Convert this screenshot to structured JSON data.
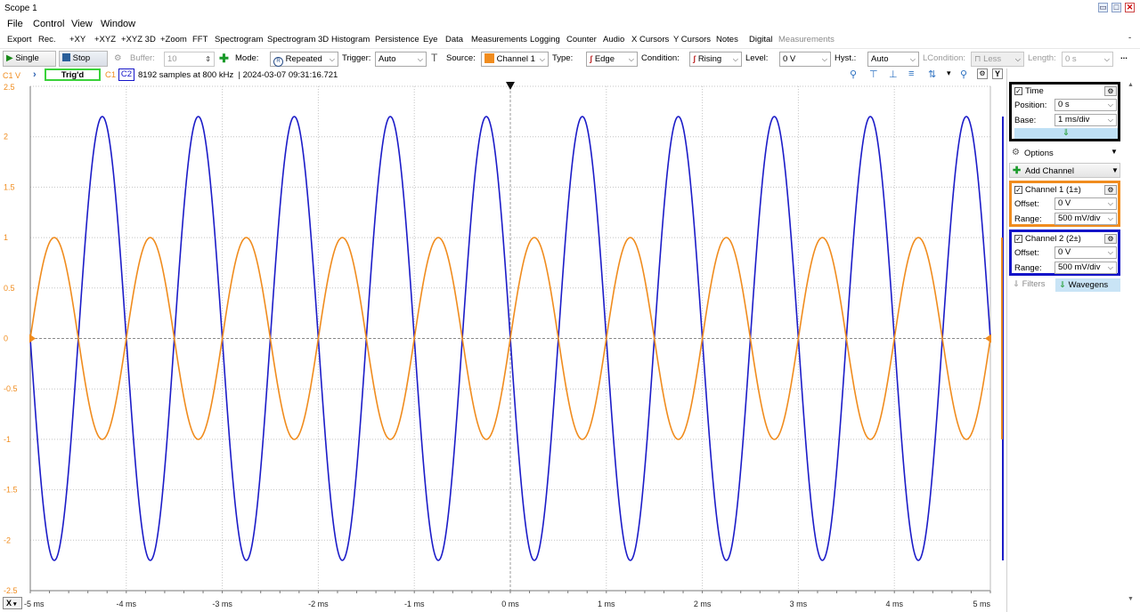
{
  "window": {
    "title": "Scope 1"
  },
  "menu": [
    "File",
    "Control",
    "View",
    "Window"
  ],
  "toolbar1": {
    "items": [
      "Export",
      "Rec.",
      "+XY",
      "+XYZ",
      "+XYZ 3D",
      "+Zoom",
      "FFT",
      "Spectrogram",
      "Spectrogram 3D",
      "Histogram",
      "Persistence",
      "Eye",
      "Data",
      "Measurements",
      "Logging",
      "Counter",
      "Audio",
      "X Cursors",
      "Y Cursors",
      "Notes",
      "Digital"
    ],
    "disabled_item": "Measurements"
  },
  "toolbar2": {
    "single_label": "Single",
    "stop_label": "Stop",
    "buffer_label": "Buffer:",
    "buffer_value": "10",
    "mode_label": "Mode:",
    "mode_value": "Repeated",
    "trigger_label": "Trigger:",
    "trigger_value": "Auto",
    "source_label": "Source:",
    "source_value": "Channel 1",
    "type_label": "Type:",
    "type_value": "Edge",
    "condition_label": "Condition:",
    "condition_value": "Rising",
    "level_label": "Level:",
    "level_value": "0 V",
    "hyst_label": "Hyst.:",
    "hyst_value": "Auto",
    "lcondition_label": "LCondition:",
    "lcondition_value": "Less",
    "length_label": "Length:",
    "length_value": "0 s",
    "more_label": "..."
  },
  "status": {
    "unit_label": "C1 V",
    "trig_label": "Trig'd",
    "c1_label": "C1",
    "c2_label": "C2",
    "info": "8192 samples at 800 kHz  | 2024-03-07 09:31:16.721",
    "y_button": "Y"
  },
  "chart_data": {
    "type": "line",
    "title": "",
    "xlabel": "",
    "ylabel": "C1 V",
    "x_unit": "ms",
    "xlim": [
      -5,
      5
    ],
    "ylim": [
      -2.5,
      2.5
    ],
    "grid": true,
    "x_ticks": [
      "-5 ms",
      "-4 ms",
      "-3 ms",
      "-2 ms",
      "-1 ms",
      "0 ms",
      "1 ms",
      "2 ms",
      "3 ms",
      "4 ms",
      "5 ms"
    ],
    "y_ticks": [
      "2.5",
      "2",
      "1.5",
      "1",
      "0.5",
      "0",
      "-0.5",
      "-1",
      "-1.5",
      "-2",
      "-2.5"
    ],
    "series": [
      {
        "name": "Channel 1",
        "color": "#f08c1e",
        "waveform": "sine",
        "frequency_khz": 1.0,
        "amplitude": 1.0,
        "phase_deg": 0
      },
      {
        "name": "Channel 2",
        "color": "#1c1cc8",
        "waveform": "sine",
        "frequency_khz": 1.0,
        "amplitude": 2.2,
        "phase_deg": 180
      }
    ],
    "trigger_level": 0
  },
  "time_panel": {
    "title": "Time",
    "position_label": "Position:",
    "position_value": "0 s",
    "base_label": "Base:",
    "base_value": "1 ms/div"
  },
  "options_label": "Options",
  "add_channel_label": "Add Channel",
  "channel1": {
    "title": "Channel 1 (1±)",
    "offset_label": "Offset:",
    "offset_value": "0 V",
    "range_label": "Range:",
    "range_value": "500 mV/div",
    "color": "#f08c1e"
  },
  "channel2": {
    "title": "Channel 2 (2±)",
    "offset_label": "Offset:",
    "offset_value": "0 V",
    "range_label": "Range:",
    "range_value": "500 mV/div",
    "color": "#1414c8"
  },
  "bottom_tabs": {
    "filters": "Filters",
    "wavegens": "Wavegens"
  },
  "x_button": "X"
}
